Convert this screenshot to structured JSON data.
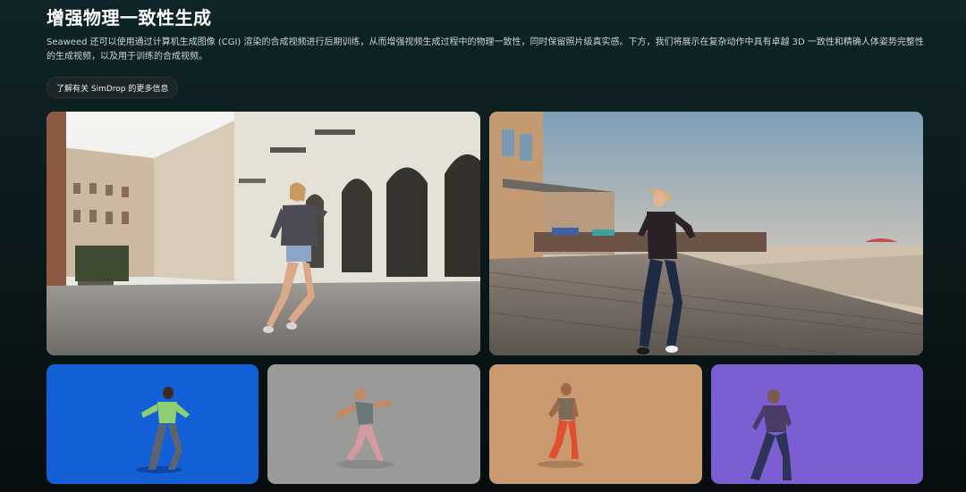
{
  "section": {
    "title": "增强物理一致性生成",
    "description": "Seaweed 还可以使用通过计算机生成图像 (CGI) 渲染的合成视频进行后期训练，从而增强视频生成过程中的物理一致性，同时保留照片级真实感。下方，我们将展示在复杂动作中具有卓越 3D 一致性和精确人体姿势完整性的生成视频，以及用于训练的合成视频。",
    "learn_more_label": "了解有关 SimDrop 的更多信息"
  },
  "videos": {
    "generated": [
      {
        "scene": "european-street-dancer"
      },
      {
        "scene": "beach-boardwalk-dancer"
      }
    ],
    "synthetic": [
      {
        "scene": "cgi-dancer-blue-background",
        "color": "#1360d6"
      },
      {
        "scene": "cgi-dancer-gray-background",
        "color": "#9a9b98"
      },
      {
        "scene": "cgi-dancer-tan-background",
        "color": "#c99a70"
      },
      {
        "scene": "cgi-dancer-purple-background",
        "color": "#7b5fd2"
      }
    ]
  }
}
